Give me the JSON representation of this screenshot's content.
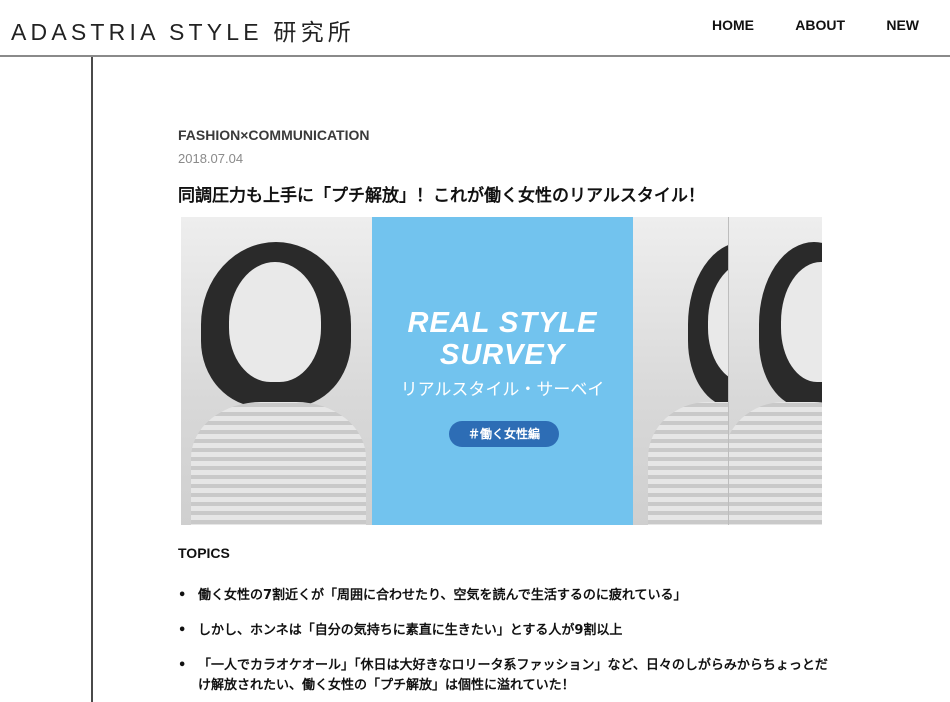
{
  "header": {
    "logo": "ADASTRIA STYLE 研究所",
    "nav": [
      {
        "label": "HOME"
      },
      {
        "label": "ABOUT"
      },
      {
        "label": "NEW"
      }
    ]
  },
  "article": {
    "category": "FASHION×COMMUNICATION",
    "date": "2018.07.04",
    "title": "同調圧力も上手に「プチ解放」！これが働く女性のリアルスタイル！",
    "hero": {
      "line1": "REAL STYLE",
      "line2": "SURVEY",
      "kana": "リアルスタイル・サーベイ",
      "tag": "＃働く女性編",
      "panel_color": "#72c3ee",
      "tag_color": "#2d6db5"
    },
    "topics_heading": "TOPICS",
    "topics": [
      "働く女性の7割近くが「周囲に合わせたり、空気を読んで生活するのに疲れている」",
      "しかし、ホンネは「自分の気持ちに素直に生きたい」とする人が9割以上",
      "「一人でカラオケオール」「休日は大好きなロリータ系ファッション」など、日々のしがらみからちょっとだけ解放されたい、働く女性の「プチ解放」は個性に溢れていた！"
    ],
    "bullet_glyph": "•"
  }
}
